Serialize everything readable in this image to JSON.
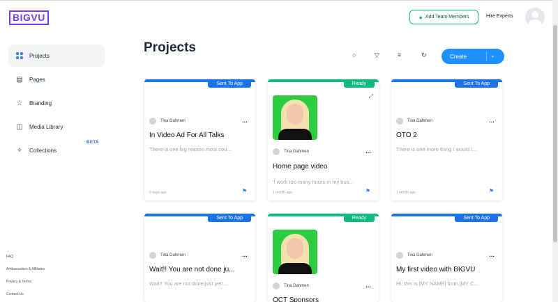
{
  "header": {
    "logo": "BIGVU",
    "add_team_label": "Add Team Members",
    "hire_label": "Hire Experts"
  },
  "sidebar": {
    "items": [
      {
        "label": "Projects",
        "icon": "grid-icon"
      },
      {
        "label": "Pages",
        "icon": "pages-icon"
      },
      {
        "label": "Branding",
        "icon": "star-icon"
      },
      {
        "label": "Media Library",
        "icon": "media-library-icon"
      },
      {
        "label": "Collections",
        "icon": "collections-icon"
      }
    ],
    "beta_label": "BETA",
    "footer": [
      "FAQ",
      "Ambassadors & Affiliates",
      "Privacy & Terms",
      "Contact Us"
    ]
  },
  "main": {
    "title": "Projects",
    "create_label": "Create"
  },
  "colors": {
    "accent": "#1e90ff",
    "sent_badge": "#1a73e8",
    "ready_badge": "#10b981",
    "logo": "#7c3aed"
  },
  "cards": [
    {
      "status": "Sent To App",
      "owner": "Tina Dahmen",
      "title": "In Video Ad For All Talks",
      "desc": "There is one big reason most cou...",
      "date": "6 days ago",
      "has_thumb": false
    },
    {
      "status": "Ready",
      "owner": "Tina Dahmen",
      "title": "Home page video",
      "desc": "'I work too many hours in my bus...",
      "date": "1 month ago",
      "has_thumb": true
    },
    {
      "status": "Sent To App",
      "owner": "Tina Dahmen",
      "title": "OTO 2",
      "desc": "There is one more thing I would l...",
      "date": "1 month ago",
      "has_thumb": false
    },
    {
      "status": "Sent To App",
      "owner": "Tina Dahmen",
      "title": "Wait!! You are not done ju...",
      "desc": "Wait!! You are not done just yet! ...",
      "date": "",
      "has_thumb": false
    },
    {
      "status": "Ready",
      "owner": "Tina Dahmen",
      "title": "OCT Sponsors",
      "desc": "",
      "date": "",
      "has_thumb": true
    },
    {
      "status": "Sent To App",
      "owner": "Tina Dahmen",
      "title": "My first video with BIGVU",
      "desc": "Hi, this is [MY NAME] from [MY C...",
      "date": "",
      "has_thumb": false
    }
  ]
}
